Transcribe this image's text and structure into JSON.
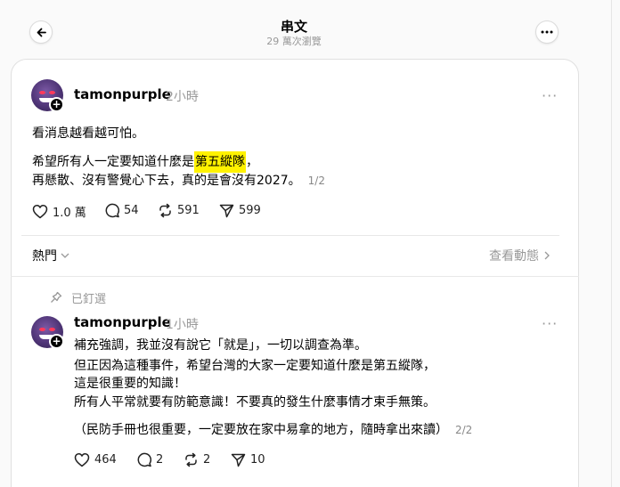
{
  "header": {
    "title": "串文",
    "views": "29 萬次瀏覽"
  },
  "post": {
    "username": "tamonpurple",
    "time": "2小時",
    "line1": "看消息越看越可怕。",
    "line2_before": "希望所有人一定要知道什麼是",
    "line2_highlight": "第五縱隊",
    "line2_after": "，",
    "line3": "再懸散、沒有警覺心下去，真的是會沒有2027。",
    "pager": "1/2",
    "likes": "1.0 萬",
    "comments": "54",
    "reposts": "591",
    "shares": "599"
  },
  "sort": {
    "label": "熱門",
    "activity": "查看動態"
  },
  "reply": {
    "pinned_label": "已釘選",
    "username": "tamonpurple",
    "time": "1小時",
    "lines": [
      "補充強調，我並沒有說它「就是」，一切以調查為準。",
      "但正因為這種事件，希望台灣的大家一定要知道什麼是第五縱隊，",
      "這是很重要的知識！",
      "所有人平常就要有防範意識！不要真的發生什麼事情才束手無策。"
    ],
    "line5": "（民防手冊也很重要，一定要放在家中易拿的地方，隨時拿出來讀）",
    "pager": "2/2",
    "likes": "464",
    "comments": "2",
    "reposts": "2",
    "shares": "10"
  },
  "icons": {
    "back": "arrow-left-icon",
    "more": "more-icon",
    "like": "heart-icon",
    "comment": "comment-icon",
    "repost": "repost-icon",
    "share": "share-icon",
    "pin": "pin-icon"
  }
}
